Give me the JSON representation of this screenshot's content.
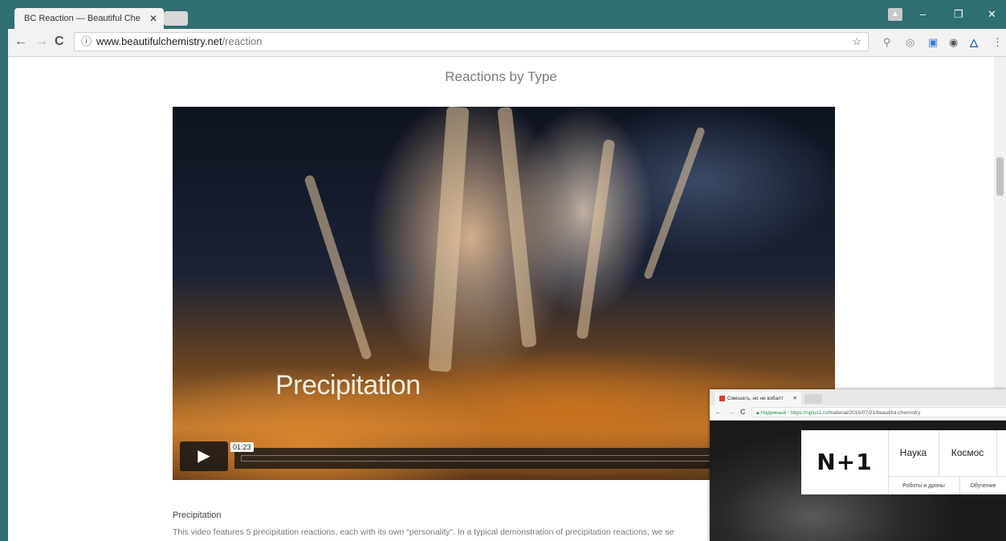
{
  "browser": {
    "tab_title": "BC  Reaction — Beautiful Che",
    "tab_close": "✕",
    "url_host": "www.beautifulchemistry.net",
    "url_path": "/reaction",
    "back": "←",
    "forward": "→",
    "reload": "C",
    "info": "ⓘ",
    "star": "☆",
    "win_min": "–",
    "win_max": "❐",
    "win_close": "✕",
    "profile": "▲"
  },
  "page": {
    "section_title": "Reactions by Type",
    "video": {
      "caption": "Precipitation",
      "play": "▶",
      "timecode": "01:23"
    },
    "description_title": "Precipitation",
    "description_text": "This video features 5 precipitation reactions, each with its own “personality”. In a typical demonstration of precipitation reactions, we se"
  },
  "overlay": {
    "tab_title": "Смешать, но не взбалт",
    "tab_close": "✕",
    "secure_label": "Надежный",
    "url_host": "https://nplus1.ru",
    "url_path": "/material/2016/07/21/beautiful-chemistry",
    "logo": "N+1",
    "nav": [
      "Наука",
      "Космос"
    ],
    "subnav": [
      "Роботы и дроны",
      "Обучение"
    ]
  },
  "colors": {
    "desktop": "#2f6e72",
    "video_orange": "#c8711e",
    "secure_green": "#1e8e3e"
  },
  "icons": [
    "back-icon",
    "forward-icon",
    "reload-icon",
    "info-icon",
    "star-icon",
    "extension-icons",
    "play-icon"
  ]
}
